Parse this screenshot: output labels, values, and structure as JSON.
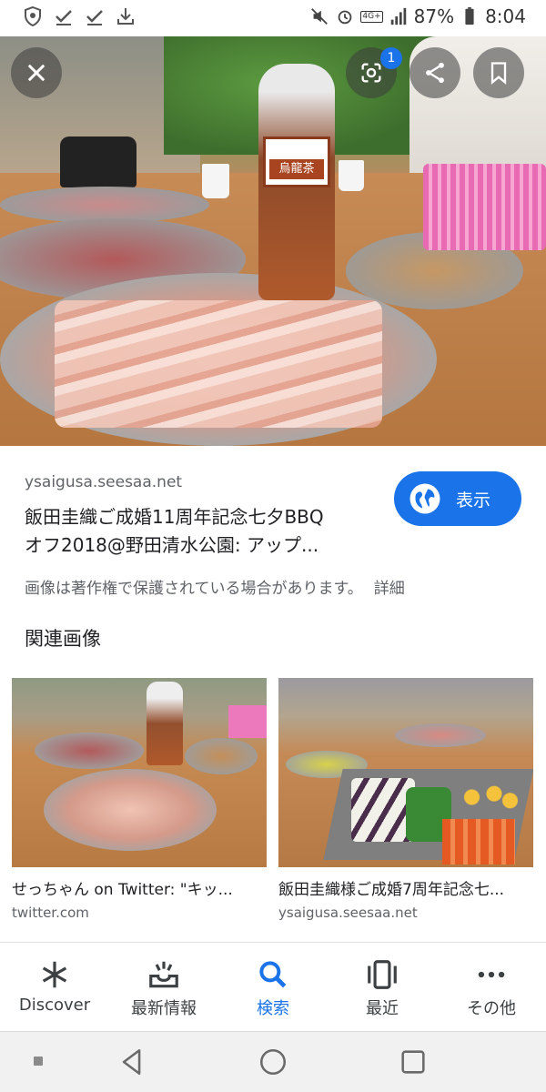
{
  "status_bar": {
    "battery": "87%",
    "time": "8:04",
    "network": "4G+"
  },
  "hero": {
    "lens_badge_count": "1",
    "bottle_label": "烏龍茶"
  },
  "result": {
    "source": "ysaigusa.seesaa.net",
    "title_line1": "飯田圭織ご成婚11周年記念七夕BBQ",
    "title_line2": "オフ2018@野田清水公園: アップ...",
    "visit_label": "表示",
    "copyright_notice": "画像は著作権で保護されている場合があります。",
    "details_link": "詳細"
  },
  "related": {
    "title": "関連画像",
    "items": [
      {
        "caption": "せっちゃん on Twitter: \"キッ...",
        "domain": "twitter.com"
      },
      {
        "caption": "飯田圭織様ご成婚7周年記念七...",
        "domain": "ysaigusa.seesaa.net"
      }
    ]
  },
  "bottom_nav": {
    "items": [
      {
        "label": "Discover",
        "icon": "asterisk-icon"
      },
      {
        "label": "最新情報",
        "icon": "updates-tray-icon"
      },
      {
        "label": "検索",
        "icon": "search-icon"
      },
      {
        "label": "最近",
        "icon": "recent-tabs-icon"
      },
      {
        "label": "その他",
        "icon": "more-dots-icon"
      }
    ],
    "active_index": 2
  },
  "colors": {
    "accent": "#1a73e8",
    "text_primary": "#202124",
    "text_secondary": "#5f6368"
  }
}
